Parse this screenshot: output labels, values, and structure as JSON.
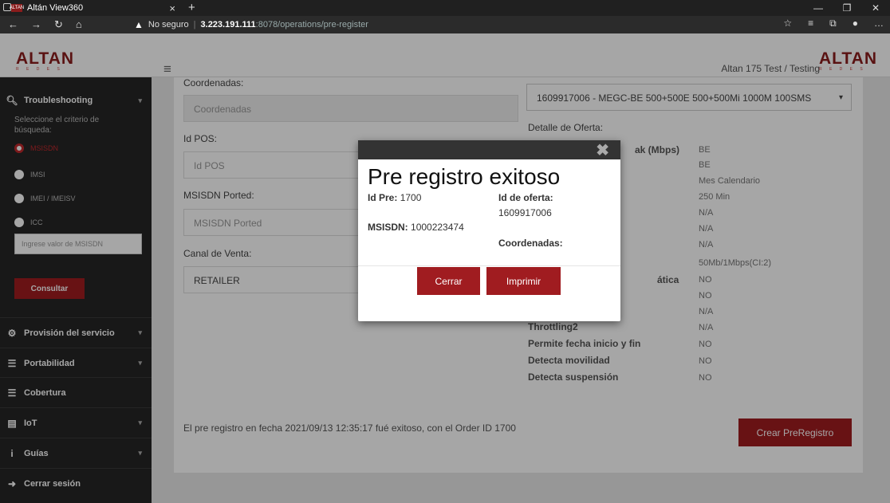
{
  "browser": {
    "tab_title": "Altán View360",
    "favicon_text": "ALTAN",
    "security_label": "No seguro",
    "url_host": "3.223.191.111",
    "url_path": ":8078/operations/pre-register"
  },
  "header": {
    "logo": "ALTAN",
    "logo_sub": "R E D E S",
    "user": "Altan 175 Test / Testing"
  },
  "sidebar": {
    "troubleshooting": "Troubleshooting",
    "criterio": "Seleccione el criterio de búsqueda:",
    "radios": [
      "MSISDN",
      "IMSI",
      "IMEI / IMEISV",
      "ICC"
    ],
    "input_placeholder": "Ingrese valor de MSISDN",
    "consultar": "Consultar",
    "items": [
      "Provisión del servicio",
      "Portabilidad",
      "Cobertura",
      "IoT",
      "Guías",
      "Cerrar sesión"
    ]
  },
  "form": {
    "coordenadas_label": "Coordenadas:",
    "coordenadas_placeholder": "Coordenadas",
    "idpos_label": "Id POS:",
    "idpos_placeholder": "Id POS",
    "msisdn_ported_label": "MSISDN Ported:",
    "msisdn_ported_placeholder": "MSISDN Ported",
    "canal_label": "Canal de Venta:",
    "canal_value": "RETAILER",
    "offer_select": "1609917006 - MEGC-BE 500+500E 500+500Mi 1000M 100SMS",
    "detalle_label": "Detalle de Oferta:"
  },
  "detail": {
    "rows": [
      "ak (Mbps)",
      "ática",
      "Throttling2",
      "Permite fecha inicio y fin",
      "Detecta movilidad",
      "Detecta suspensión"
    ],
    "values": [
      "BE",
      "BE",
      "Mes Calendario",
      "250 Min",
      "N/A",
      "N/A",
      "N/A",
      "50Mb/1Mbps(CI:2)",
      "NO",
      "NO",
      "N/A",
      "N/A",
      "NO",
      "NO",
      "NO"
    ]
  },
  "footer_msg": "El pre registro en fecha 2021/09/13 12:35:17 fué exitoso, con el Order ID 1700",
  "crear_button": "Crear PreRegistro",
  "modal": {
    "title": "Pre registro exitoso",
    "idpre_label": "Id Pre:",
    "idpre_value": "1700",
    "oferta_label": "Id de oferta:",
    "oferta_value": "1609917006",
    "msisdn_label": "MSISDN:",
    "msisdn_value": "1000223474",
    "coord_label": "Coordenadas:",
    "cerrar": "Cerrar",
    "imprimir": "Imprimir"
  },
  "colors": {
    "brand": "#a01c20",
    "sidebar": "#262626"
  }
}
